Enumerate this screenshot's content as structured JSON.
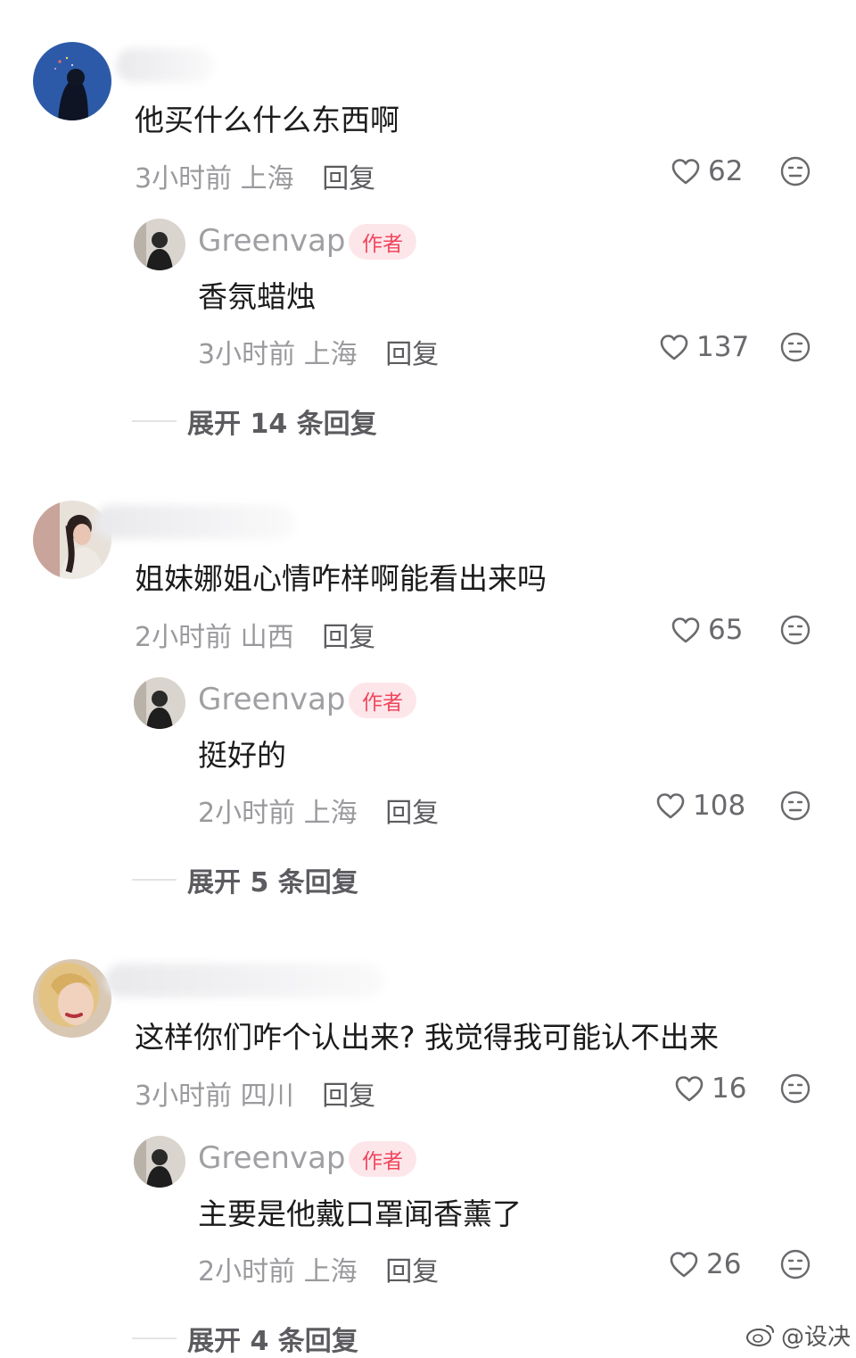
{
  "threads": [
    {
      "comment": {
        "text": "他买什么什么东西啊",
        "time": "3小时前",
        "location": "上海",
        "reply_label": "回复",
        "likes": "62"
      },
      "author_reply": {
        "username": "Greenvap",
        "badge": "作者",
        "text": "香氛蜡烛",
        "time": "3小时前",
        "location": "上海",
        "reply_label": "回复",
        "likes": "137"
      },
      "expand_label": "展开 14 条回复"
    },
    {
      "comment": {
        "text": "姐妹娜姐心情咋样啊能看出来吗",
        "time": "2小时前",
        "location": "山西",
        "reply_label": "回复",
        "likes": "65"
      },
      "author_reply": {
        "username": "Greenvap",
        "badge": "作者",
        "text": "挺好的",
        "time": "2小时前",
        "location": "上海",
        "reply_label": "回复",
        "likes": "108"
      },
      "expand_label": "展开 5 条回复"
    },
    {
      "comment": {
        "text": "这样你们咋个认出来? 我觉得我可能认不出来",
        "time": "3小时前",
        "location": "四川",
        "reply_label": "回复",
        "likes": "16"
      },
      "author_reply": {
        "username": "Greenvap",
        "badge": "作者",
        "text": "主要是他戴口罩闻香薰了",
        "time": "2小时前",
        "location": "上海",
        "reply_label": "回复",
        "likes": "26"
      },
      "expand_label": "展开 4 条回复"
    }
  ],
  "watermark": "@设决",
  "colors": {
    "badge_text": "#f0465c",
    "badge_bg": "#fde6ea",
    "meta_gray": "#9a9a9e"
  },
  "icons": {
    "like": "heart-outline-icon",
    "dislike": "neutral-face-icon"
  }
}
